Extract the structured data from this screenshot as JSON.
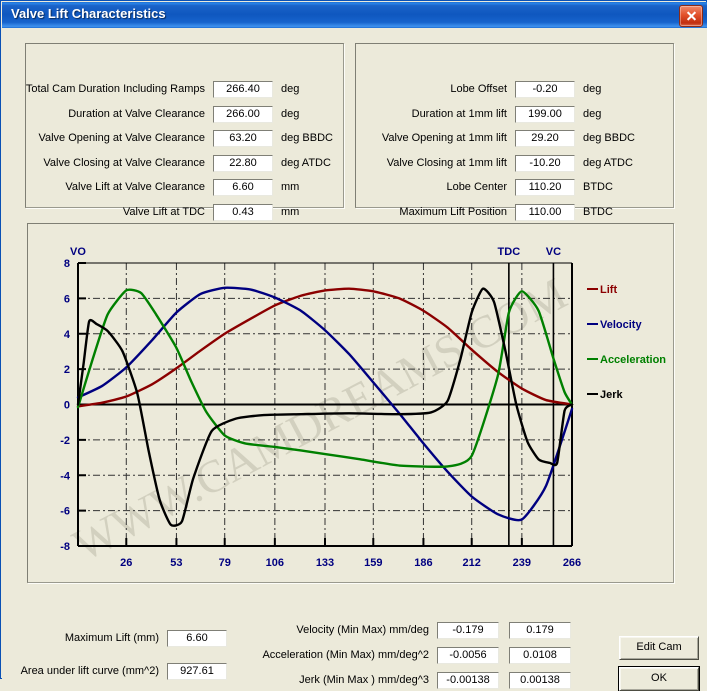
{
  "window": {
    "title": "Valve Lift Characteristics",
    "close_label": "Close"
  },
  "left_group": {
    "rows": [
      {
        "label": "Total Cam Duration Including Ramps",
        "value": "266.40",
        "unit": "deg"
      },
      {
        "label": "Duration at Valve Clearance",
        "value": "266.00",
        "unit": "deg"
      },
      {
        "label": "Valve Opening at Valve Clearance",
        "value": "63.20",
        "unit": "deg BBDC"
      },
      {
        "label": "Valve Closing at Valve Clearance",
        "value": "22.80",
        "unit": "deg ATDC"
      },
      {
        "label": "Valve Lift at Valve Clearance",
        "value": "6.60",
        "unit": "mm"
      },
      {
        "label": "Valve Lift at TDC",
        "value": "0.43",
        "unit": "mm"
      }
    ]
  },
  "right_group": {
    "rows": [
      {
        "label": "Lobe Offset",
        "value": "-0.20",
        "unit": "deg"
      },
      {
        "label": "Duration at 1mm lift",
        "value": "199.00",
        "unit": "deg"
      },
      {
        "label": "Valve Opening at 1mm lift",
        "value": "29.20",
        "unit": "deg BBDC"
      },
      {
        "label": "Valve Closing at 1mm lift",
        "value": "-10.20",
        "unit": "deg ATDC"
      },
      {
        "label": "Lobe Center",
        "value": "110.20",
        "unit": "BTDC"
      },
      {
        "label": "Maximum Lift Position",
        "value": "110.00",
        "unit": "BTDC"
      }
    ]
  },
  "bottom_left": {
    "rows": [
      {
        "label": "Maximum Lift (mm)",
        "value": "6.60"
      },
      {
        "label": "Area under lift curve (mm^2)",
        "value": "927.61"
      }
    ]
  },
  "bottom_middle": {
    "rows": [
      {
        "label": "Velocity (Min Max)  mm/deg",
        "min": "-0.179",
        "max": "0.179"
      },
      {
        "label": "Acceleration (Min Max) mm/deg^2",
        "min": "-0.0056",
        "max": "0.0108"
      },
      {
        "label": "Jerk (Min Max ) mm/deg^3",
        "min": "-0.00138",
        "max": "0.00138"
      }
    ]
  },
  "buttons": {
    "edit_cam": "Edit Cam",
    "ok": "OK"
  },
  "watermark": "WWW.CAMDREAMS.COM",
  "chart_data": {
    "type": "line",
    "title": "",
    "xlabel": "",
    "ylabel": "",
    "xlim": [
      0,
      266
    ],
    "ylim": [
      -8,
      8
    ],
    "grid": true,
    "legend_position": "right",
    "x_ticks": [
      26,
      53,
      79,
      106,
      133,
      159,
      186,
      212,
      239,
      266
    ],
    "y_ticks": [
      -8,
      -6,
      -4,
      -2,
      0,
      2,
      4,
      6,
      8
    ],
    "markers": [
      {
        "label": "VO",
        "x": 0,
        "color": "#000080"
      },
      {
        "label": "TDC",
        "x": 232,
        "color": "#000080"
      },
      {
        "label": "VC",
        "x": 256,
        "color": "#000080"
      }
    ],
    "series": [
      {
        "name": "Lift",
        "color": "#8B0000",
        "x": [
          0,
          13,
          26,
          40,
          53,
          66,
          79,
          93,
          106,
          120,
          133,
          146,
          159,
          173,
          186,
          199,
          212,
          226,
          239,
          252,
          266
        ],
        "y": [
          -0.1,
          0.1,
          0.45,
          1.15,
          2.05,
          3.05,
          4.0,
          4.85,
          5.6,
          6.15,
          6.45,
          6.55,
          6.4,
          6.0,
          5.3,
          4.35,
          3.1,
          1.85,
          0.9,
          0.25,
          0.0
        ]
      },
      {
        "name": "Velocity",
        "color": "#000080",
        "x": [
          0,
          13,
          26,
          40,
          53,
          66,
          79,
          93,
          106,
          120,
          133,
          146,
          159,
          173,
          186,
          199,
          212,
          226,
          239,
          252,
          266
        ],
        "y": [
          0.4,
          1.05,
          2.1,
          3.65,
          5.2,
          6.25,
          6.6,
          6.5,
          6.05,
          5.3,
          4.2,
          2.85,
          1.25,
          -0.5,
          -2.2,
          -3.8,
          -5.2,
          -6.2,
          -6.5,
          -4.6,
          -0.25
        ]
      },
      {
        "name": "Acceleration",
        "color": "#008000",
        "x": [
          0,
          8,
          16,
          26,
          34,
          42,
          53,
          61,
          69,
          79,
          90,
          106,
          120,
          133,
          152,
          173,
          199,
          212,
          226,
          232,
          239,
          248,
          256,
          262,
          266
        ],
        "y": [
          -0.15,
          2.6,
          5.1,
          6.45,
          6.3,
          5.1,
          3.2,
          1.3,
          -0.4,
          -1.75,
          -2.2,
          -2.4,
          -2.6,
          -2.8,
          -3.1,
          -3.45,
          -3.5,
          -2.9,
          1.6,
          5.2,
          6.4,
          5.3,
          2.6,
          0.7,
          0.0
        ]
      },
      {
        "name": "Jerk",
        "color": "#000000",
        "x": [
          0,
          3,
          6,
          10,
          16,
          24,
          32,
          38,
          44,
          50,
          56,
          62,
          72,
          85,
          100,
          120,
          146,
          173,
          190,
          199,
          206,
          212,
          218,
          224,
          230,
          236,
          242,
          248,
          254,
          258,
          262,
          266
        ],
        "y": [
          0.0,
          2.3,
          4.7,
          4.55,
          4.15,
          3.0,
          0.6,
          -2.6,
          -5.4,
          -6.8,
          -6.6,
          -4.2,
          -1.5,
          -0.8,
          -0.6,
          -0.55,
          -0.5,
          -0.55,
          -0.45,
          0.2,
          2.6,
          5.2,
          6.55,
          5.8,
          3.1,
          0.0,
          -2.1,
          -3.1,
          -3.3,
          -3.3,
          -0.35,
          0.0
        ]
      }
    ]
  }
}
